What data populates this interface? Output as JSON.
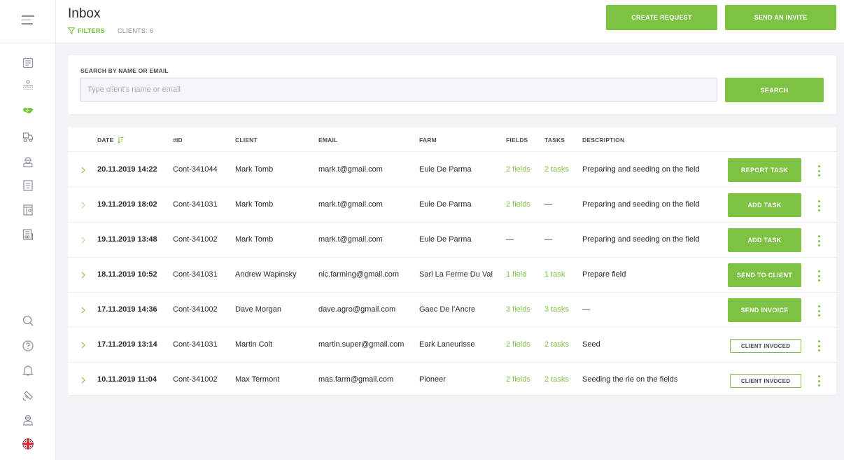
{
  "header": {
    "title": "Inbox",
    "filters_label": "FILTERS",
    "clients_label": "CLIENTS: 6",
    "create_request_label": "CREATE REQUEST",
    "send_invite_label": "SEND AN INVITE"
  },
  "sidebar": {
    "items": [
      "dashboard-icon",
      "crops-icon",
      "handshake-icon",
      "machinery-icon",
      "worker-icon",
      "document-icon",
      "book-icon",
      "report-icon"
    ],
    "bottom_items": [
      "search-icon",
      "help-icon",
      "bell-icon",
      "satellite-icon",
      "profile-icon",
      "uk-flag-icon"
    ],
    "active_item": "handshake-icon"
  },
  "search": {
    "label": "SEARCH BY NAME OR EMAIL",
    "placeholder": "Type client's name or email",
    "value": "",
    "button_label": "SEARCH"
  },
  "table": {
    "columns": {
      "date": "DATE",
      "id": "#ID",
      "client": "CLIENT",
      "email": "EMAIL",
      "farm": "FARM",
      "fields": "FIELDS",
      "tasks": "TASKS",
      "description": "DESCRIPTION"
    },
    "rows": [
      {
        "date": "20.11.2019 14:22",
        "id": "Cont-341044",
        "client": "Mark Tomb",
        "email": "mark.t@gmail.com",
        "farm": "Eule De Parma",
        "fields": "2 fields",
        "tasks": "2 tasks",
        "description": "Preparing and seeding on the field",
        "action": "REPORT TASK"
      },
      {
        "date": "19.11.2019 18:02",
        "id": "Cont-341031",
        "client": "Mark Tomb",
        "email": "mark.t@gmail.com",
        "farm": "Eule De Parma",
        "fields": "2 fields",
        "tasks": "—",
        "description": "Preparing and seeding on the field",
        "action": "ADD TASK"
      },
      {
        "date": "19.11.2019 13:48",
        "id": "Cont-341002",
        "client": "Mark Tomb",
        "email": "mark.t@gmail.com",
        "farm": "Eule De Parma",
        "fields": "—",
        "tasks": "—",
        "description": "Preparing and seeding on the field",
        "action": "ADD TASK"
      },
      {
        "date": "18.11.2019 10:52",
        "id": "Cont-341031",
        "client": "Andrew Wapinsky",
        "email": "nic.farming@gmail.com",
        "farm": "Sarl La Ferme Du Val",
        "fields": "1 field",
        "tasks": "1 task",
        "description": "Prepare field",
        "action": "SEND TO CLIENT"
      },
      {
        "date": "17.11.2019 14:36",
        "id": "Cont-341002",
        "client": "Dave Morgan",
        "email": "dave.agro@gmail.com",
        "farm": "Gaec De l’Ancre",
        "fields": "3 fields",
        "tasks": "3 tasks",
        "description": "—",
        "action": "SEND INVOICE"
      },
      {
        "date": "17.11.2019 13:14",
        "id": "Cont-341031",
        "client": "Martin Colt",
        "email": "martin.super@gmail.com",
        "farm": "Eark Laneurisse",
        "fields": "2 fields",
        "tasks": "2 tasks",
        "description": "Seed",
        "action": "CLIENT INVOCED"
      },
      {
        "date": "10.11.2019 11:04",
        "id": "Cont-341002",
        "client": "Max Termont",
        "email": "mas.farm@gmail.com",
        "farm": "Pioneer",
        "fields": "2 fields",
        "tasks": "2 tasks",
        "description": "Seeding the rie on the fields",
        "action": "CLIENT INVOCED"
      }
    ]
  },
  "colors": {
    "accent": "#7dc242",
    "text": "#2b2b2b",
    "muted": "#8a8f94",
    "background": "#f3f4f5"
  }
}
